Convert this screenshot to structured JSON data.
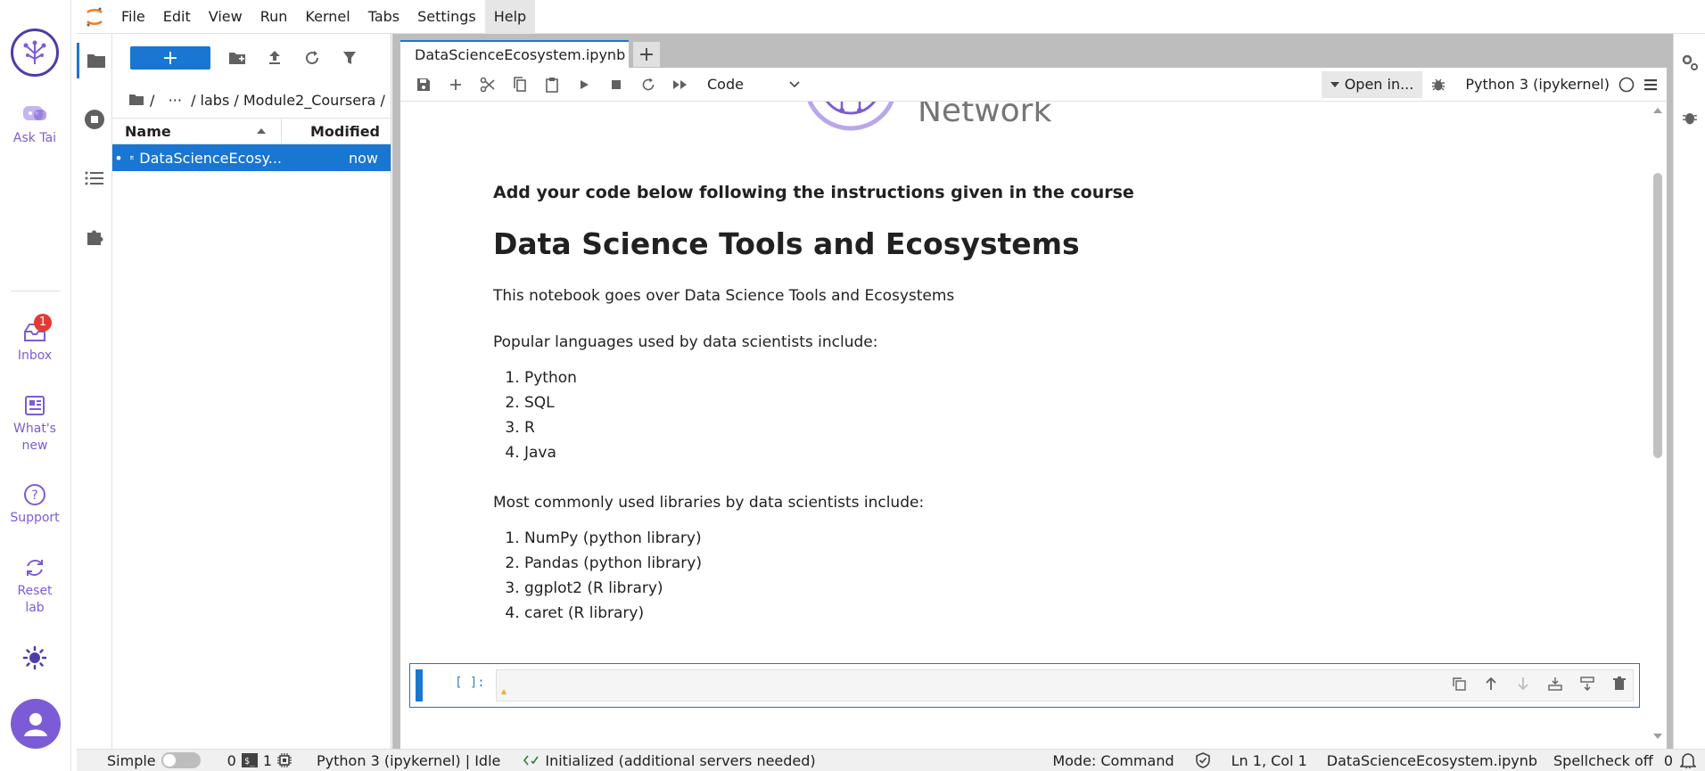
{
  "rail": {
    "ask_label": "Ask Tai",
    "inbox_label": "Inbox",
    "inbox_count": "1",
    "whatsnew_label": "What's new",
    "support_label": "Support",
    "reset_label": "Reset lab"
  },
  "menu": {
    "items": [
      "File",
      "Edit",
      "View",
      "Run",
      "Kernel",
      "Tabs",
      "Settings",
      "Help"
    ]
  },
  "filebrowser": {
    "breadcrumb": "/   ···  / labs / Module2_Coursera /",
    "col_name": "Name",
    "col_modified": "Modified",
    "rows": [
      {
        "name": "DataScienceEcosy...",
        "modified": "now"
      }
    ]
  },
  "tab": {
    "title": "DataScienceEcosystem.ipynb"
  },
  "toolbar": {
    "cell_type": "Code",
    "open_in": "Open in...",
    "kernel": "Python 3 (ipykernel)"
  },
  "notebook": {
    "banner_text": "Network",
    "intro": "Add your code below following the instructions given in the course",
    "heading": "Data Science Tools and Ecosystems",
    "summary": "This notebook goes over Data Science Tools and Ecosystems",
    "languages_intro": "Popular languages used by data scientists include:",
    "languages": [
      "Python",
      "SQL",
      "R",
      "Java"
    ],
    "libraries_intro": "Most commonly used libraries by data scientists include:",
    "libraries": [
      "NumPy (python library)",
      "Pandas (python library)",
      "ggplot2 (R library)",
      "caret (R library)"
    ],
    "prompt": "[ ]:"
  },
  "status": {
    "mode_simple": "Simple",
    "terminals": "0",
    "kernels": "1",
    "kernel_status": "Python 3 (ipykernel) | Idle",
    "lsp": "Initialized (additional servers needed)",
    "mode": "Mode: Command",
    "cursor": "Ln 1, Col 1",
    "filename": "DataScienceEcosystem.ipynb",
    "spellcheck": "Spellcheck off",
    "notifications": "0"
  },
  "colors": {
    "accent": "#1976d2",
    "rail": "#7c5cd6"
  }
}
